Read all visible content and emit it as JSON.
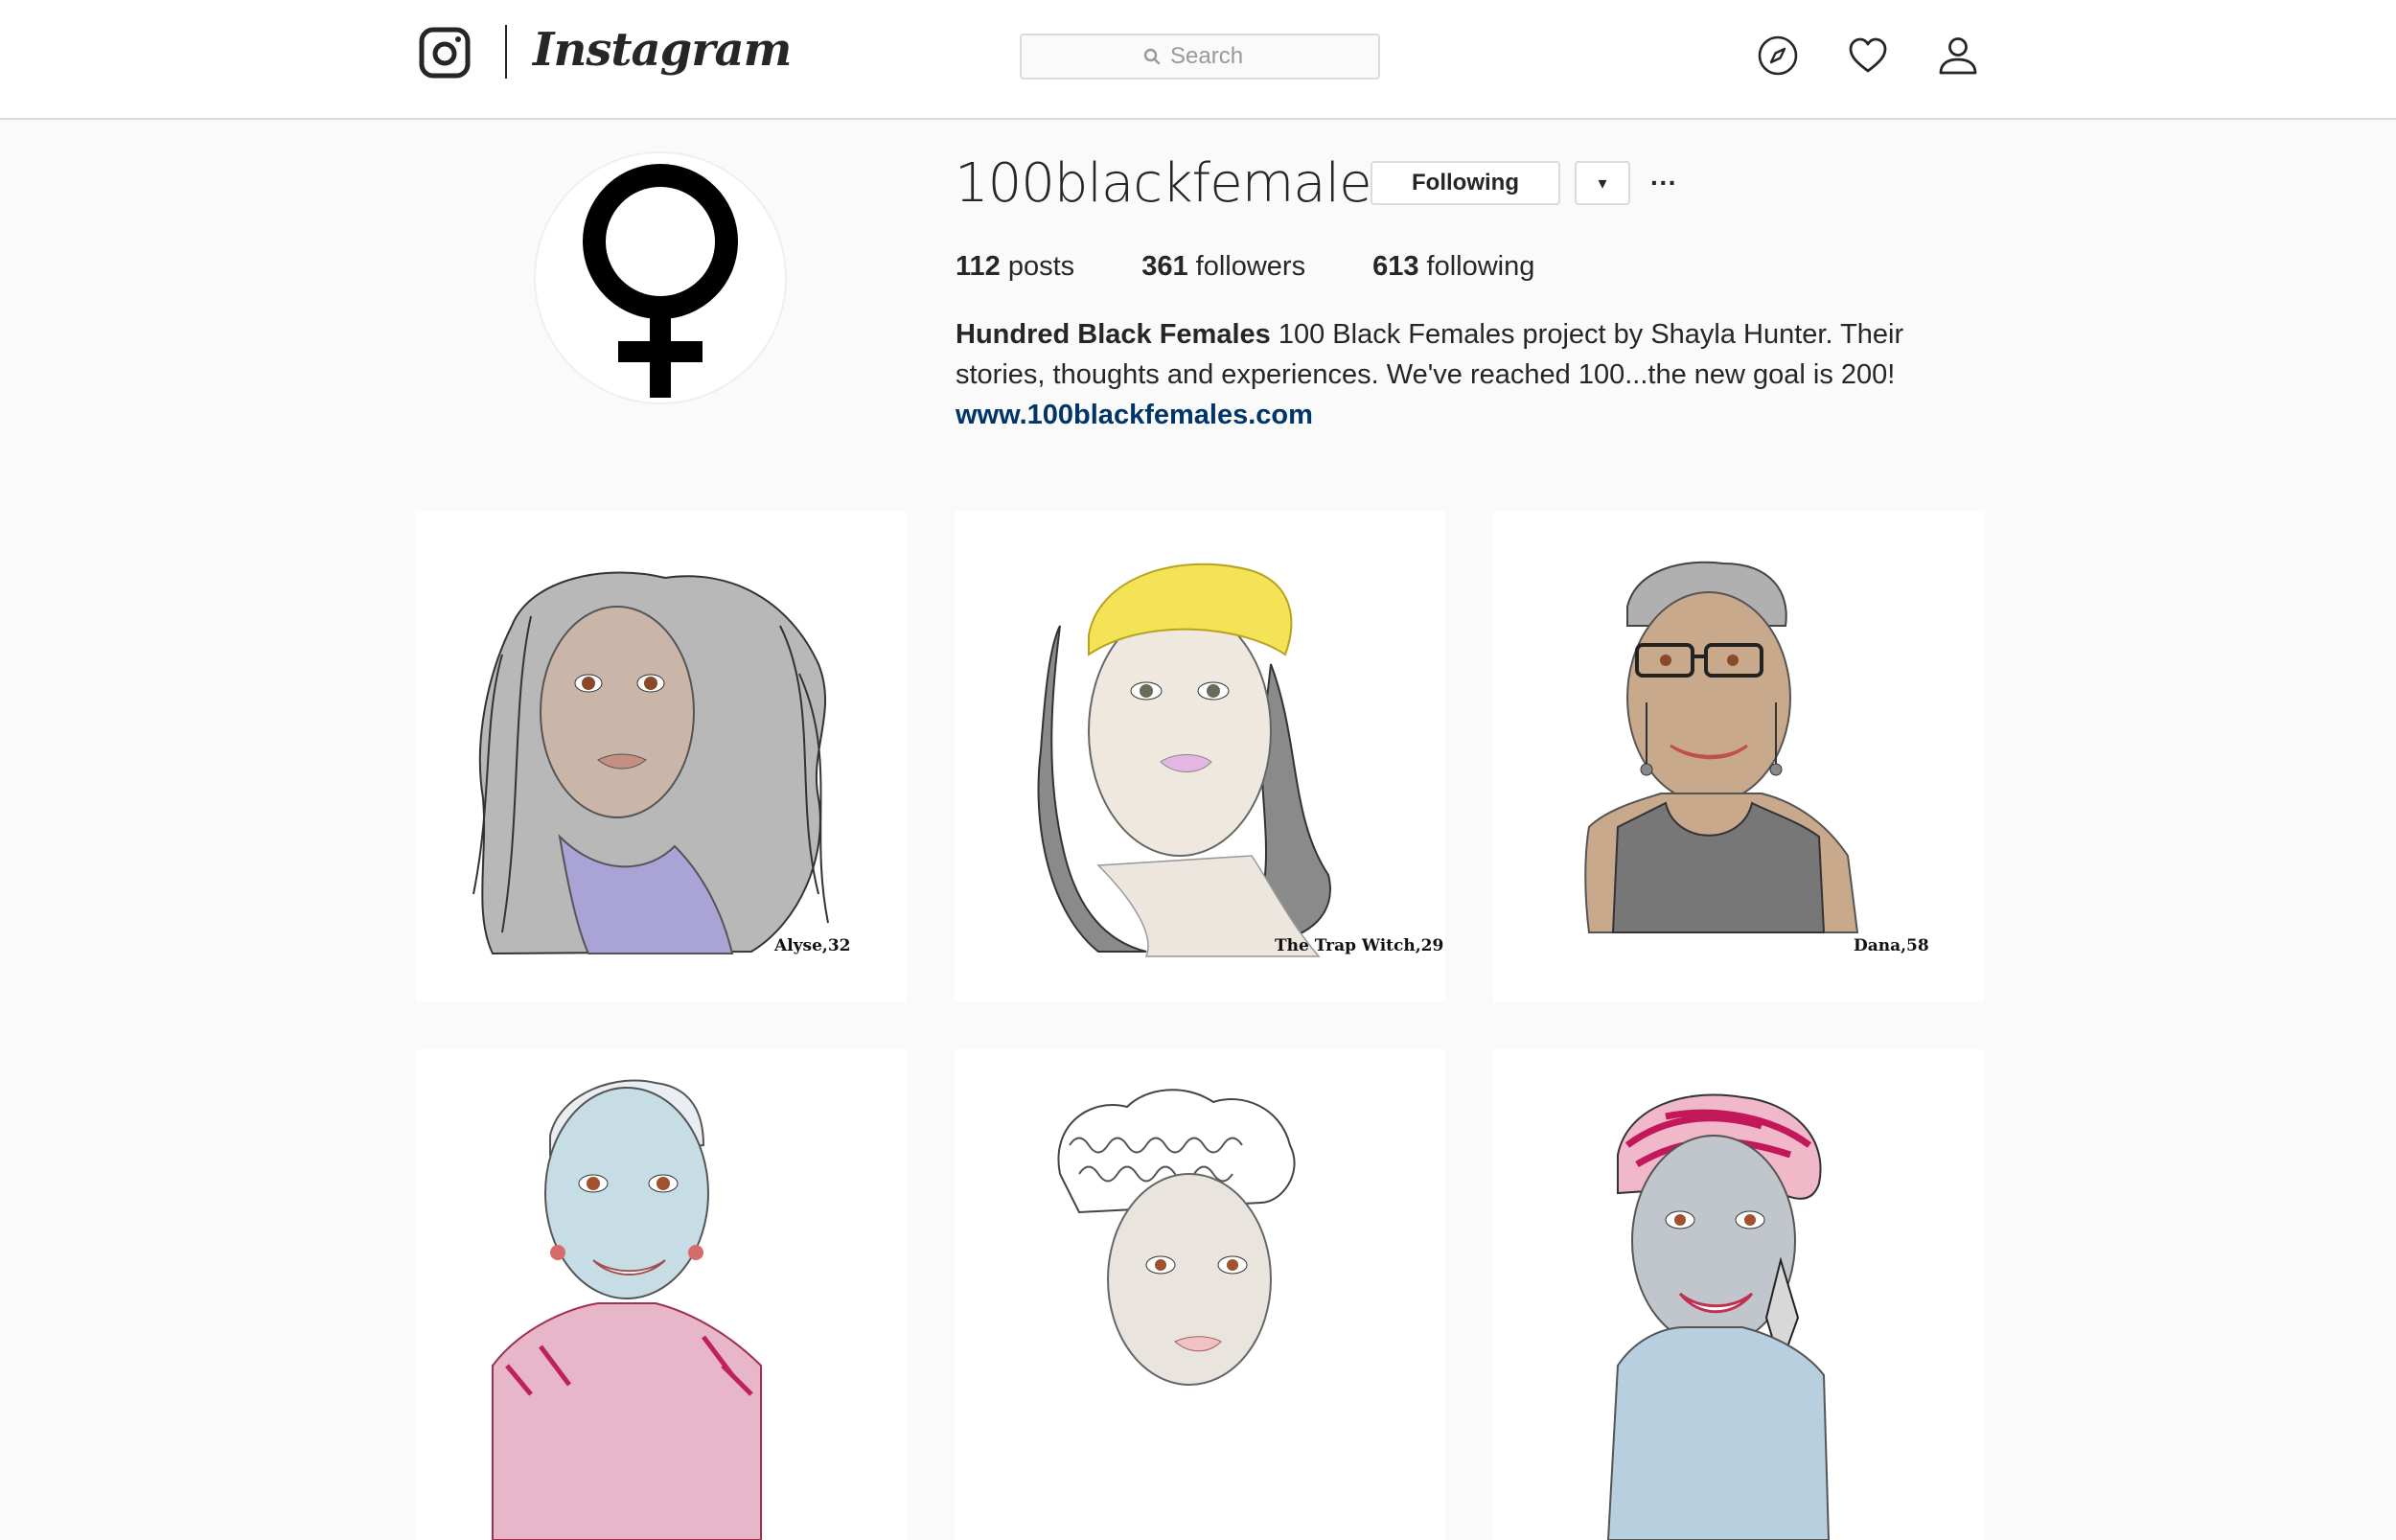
{
  "nav": {
    "wordmark": "Instagram",
    "search_placeholder": "Search"
  },
  "profile": {
    "username": "100blackfemales",
    "following_button": "Following",
    "dropdown_glyph": "▾",
    "more_glyph": "···",
    "stats": {
      "posts_count": "112",
      "posts_label": "posts",
      "followers_count": "361",
      "followers_label": "followers",
      "following_count": "613",
      "following_label": "following"
    },
    "bio": {
      "name": "Hundred Black Females",
      "text": "100 Black Females project by Shayla Hunter. Their stories, thoughts and experiences. We've reached 100...the new goal is 200!",
      "link": "www.100blackfemales.com"
    }
  },
  "posts": [
    {
      "caption": "Alyse,32"
    },
    {
      "caption": "The Trap Witch,29"
    },
    {
      "caption": "Dana,58"
    },
    {
      "caption": ""
    },
    {
      "caption": ""
    },
    {
      "caption": ""
    }
  ],
  "icons": {
    "logo": "instagram-camera-icon",
    "search": "search-icon",
    "explore": "compass-icon",
    "activity": "heart-icon",
    "profile": "person-icon",
    "avatar": "female-symbol-icon"
  }
}
